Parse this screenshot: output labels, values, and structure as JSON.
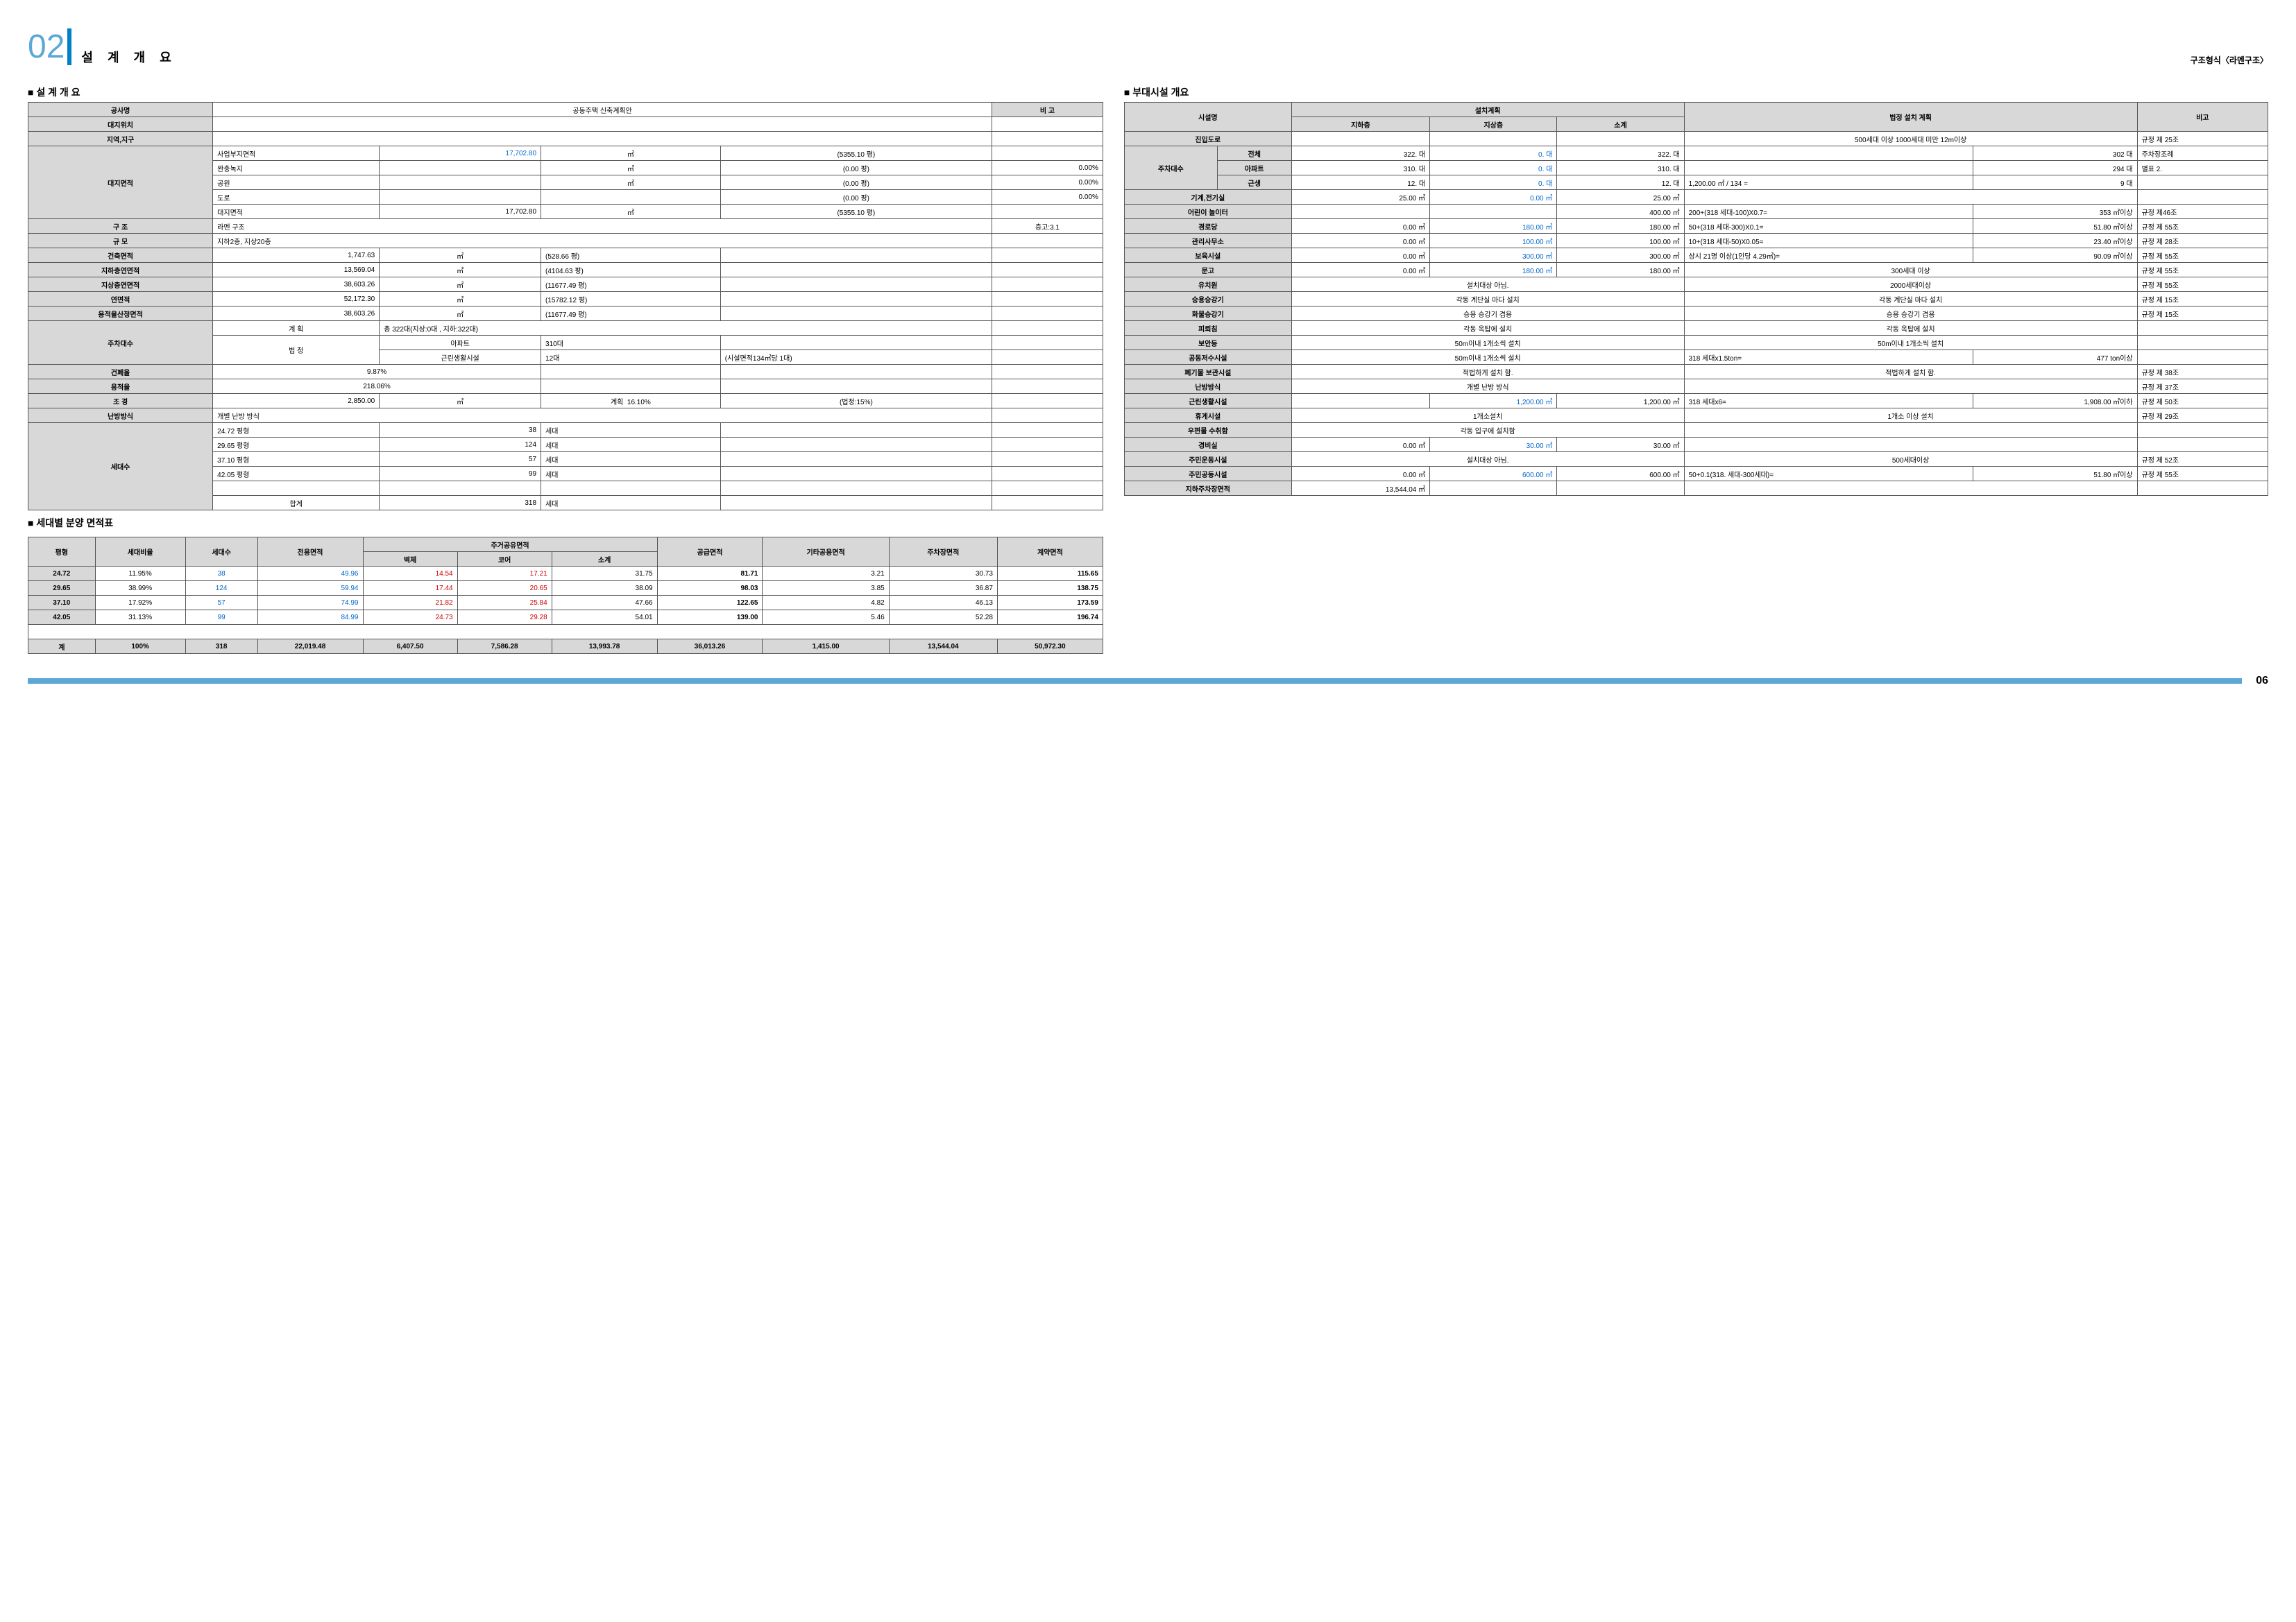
{
  "header": {
    "number_prefix": "0",
    "number_main": "2",
    "title": "설 계 개 요",
    "struct_type": "구조형식〈라멘구조〉",
    "footer_page": "06"
  },
  "sections": {
    "design_overview": "■ 설 계 개 요",
    "area_table": "■ 세대별 분양 면적표",
    "facilities": "■ 부대시설 개요"
  },
  "design": {
    "headers": {
      "project": "공사명",
      "project_val": "공동주택 신축계획안",
      "note": "비 고",
      "site_loc": "대지위치",
      "region": "지역,지구",
      "site_area": "대지면적",
      "structure": "구 조",
      "scale": "규 모",
      "bldg_area": "건축면적",
      "basement_area": "지하층연면적",
      "above_area": "지상층연면적",
      "total_area": "연면적",
      "far_area": "용적율산정면적",
      "parking": "주차대수",
      "bcr": "건폐율",
      "far": "용적율",
      "landscape": "조 경",
      "heating": "난방방식",
      "units": "세대수"
    },
    "site": {
      "biz_area_label": "사업부지면적",
      "biz_area": "17,702.80",
      "biz_unit": "㎡",
      "biz_pyung": "(5355.10 평)",
      "buffer_label": "완충녹지",
      "buffer_val": "",
      "buffer_pyung": "(0.00 평)",
      "buffer_pct": "0.00%",
      "park_label": "공원",
      "park_pyung": "(0.00 평)",
      "park_pct": "0.00%",
      "road_label": "도로",
      "road_pyung": "(0.00 평)",
      "road_pct": "0.00%",
      "lot_label": "대지면적",
      "lot_val": "17,702.80",
      "lot_unit": "㎡",
      "lot_pyung": "(5355.10 평)"
    },
    "structure_val": "라멘 구조",
    "structure_note": "층고:3.1",
    "scale_val": "지하2층, 지상20층",
    "bldg_area_val": "1,747.63",
    "bldg_area_pyung": "(528.66 평)",
    "basement_val": "13,569.04",
    "basement_pyung": "(4104.63 평)",
    "above_val": "38,603.26",
    "above_pyung": "(11677.49 평)",
    "total_val": "52,172.30",
    "total_pyung": "(15782.12 평)",
    "far_area_val": "38,603.26",
    "far_area_pyung": "(11677.49 평)",
    "unit_m2": "㎡",
    "parking": {
      "plan_label": "계 획",
      "plan_val": "총 322대(지상:0대 , 지하:322대)",
      "legal_label": "법 정",
      "apt_label": "아파트",
      "apt_val": "310대",
      "retail_label": "근린생활시설",
      "retail_val": "12대",
      "retail_note": "(시설면적134㎡당 1대)"
    },
    "bcr_val": "9.87%",
    "far_val": "218.06%",
    "landscape_val": "2,850.00",
    "landscape_plan_label": "계획",
    "landscape_plan": "16.10%",
    "landscape_legal": "(법정:15%)",
    "heating_val": "개별 난방 방식",
    "units": {
      "r1_type": "24.72 평형",
      "r1_qty": "38",
      "unit_label": "세대",
      "r2_type": "29.65 평형",
      "r2_qty": "124",
      "r3_type": "37.10 평형",
      "r3_qty": "57",
      "r4_type": "42.05 평형",
      "r4_qty": "99",
      "sum_label": "합계",
      "sum_qty": "318"
    }
  },
  "area_table": {
    "cols": {
      "type": "평형",
      "ratio": "세대비율",
      "count": "세대수",
      "exclusive": "전용면적",
      "share_header": "주거공유면적",
      "wall": "벽체",
      "core": "코어",
      "subtotal": "소계",
      "supply": "공급면적",
      "other": "기타공용면적",
      "parking": "주차장면적",
      "contract": "계약면적",
      "total_label": "계"
    },
    "rows": [
      {
        "type": "24.72",
        "ratio": "11.95%",
        "count": "38",
        "excl": "49.96",
        "wall": "14.54",
        "core": "17.21",
        "sub": "31.75",
        "supply": "81.71",
        "other": "3.21",
        "park": "30.73",
        "contract": "115.65"
      },
      {
        "type": "29.65",
        "ratio": "38.99%",
        "count": "124",
        "excl": "59.94",
        "wall": "17.44",
        "core": "20.65",
        "sub": "38.09",
        "supply": "98.03",
        "other": "3.85",
        "park": "36.87",
        "contract": "138.75"
      },
      {
        "type": "37.10",
        "ratio": "17.92%",
        "count": "57",
        "excl": "74.99",
        "wall": "21.82",
        "core": "25.84",
        "sub": "47.66",
        "supply": "122.65",
        "other": "4.82",
        "park": "46.13",
        "contract": "173.59"
      },
      {
        "type": "42.05",
        "ratio": "31.13%",
        "count": "99",
        "excl": "84.99",
        "wall": "24.73",
        "core": "29.28",
        "sub": "54.01",
        "supply": "139.00",
        "other": "5.46",
        "park": "52.28",
        "contract": "196.74"
      }
    ],
    "totals": {
      "ratio": "100%",
      "count": "318",
      "excl": "22,019.48",
      "wall": "6,407.50",
      "core": "7,586.28",
      "sub": "13,993.78",
      "supply": "36,013.26",
      "other": "1,415.00",
      "park": "13,544.04",
      "contract": "50,972.30"
    }
  },
  "facilities": {
    "cols": {
      "name": "시설명",
      "plan_header": "설치계획",
      "basement": "지하층",
      "above": "지상층",
      "subtotal": "소계",
      "legal": "법정 설치 계획",
      "note": "비고"
    },
    "rows": [
      {
        "name": "진입도로",
        "b": "",
        "a": "",
        "s": "",
        "legal": "500세대 이상 1000세대 미만 12m이상",
        "note": "규정 제 25조"
      },
      {
        "name": "전체",
        "b": "322. 대",
        "a": "0. 대",
        "s": "322. 대",
        "legal": "",
        "legal2": "302 대",
        "note": "주차장조례",
        "sub": "주차대수"
      },
      {
        "name": "아파트",
        "b": "310. 대",
        "a": "0. 대",
        "s": "310. 대",
        "legal": "",
        "legal2": "294 대",
        "note": "별표 2."
      },
      {
        "name": "근생",
        "b": "12. 대",
        "a": "0. 대",
        "s": "12. 대",
        "legal": "1,200.00 ㎡ / 134 =",
        "legal2": "9 대",
        "note": ""
      },
      {
        "name": "기계,전기실",
        "b": "25.00 ㎡",
        "a": "0.00 ㎡",
        "s": "25.00 ㎡",
        "legal": "",
        "note": ""
      },
      {
        "name": "어린이 놀이터",
        "b": "",
        "a": "",
        "s": "400.00 ㎡",
        "legal": "200+(318 세대-100)X0.7=",
        "legal2": "353 ㎡이상",
        "note": "규정 제46조"
      },
      {
        "name": "경로당",
        "b": "0.00 ㎡",
        "a": "180.00 ㎡",
        "s": "180.00 ㎡",
        "legal": "50+(318 세대-300)X0.1=",
        "legal2": "51.80 ㎡이상",
        "note": "규정 제 55조"
      },
      {
        "name": "관리사무소",
        "b": "0.00 ㎡",
        "a": "100.00 ㎡",
        "s": "100.00 ㎡",
        "legal": "10+(318 세대-50)X0.05=",
        "legal2": "23.40 ㎡이상",
        "note": "규정 제 28조"
      },
      {
        "name": "보육시설",
        "b": "0.00 ㎡",
        "a": "300.00 ㎡",
        "s": "300.00 ㎡",
        "legal": "상시 21명 이상(1인당 4.29㎡)=",
        "legal2": "90.09 ㎡이상",
        "note": "규정 제 55조"
      },
      {
        "name": "문고",
        "b": "0.00 ㎡",
        "a": "180.00 ㎡",
        "s": "180.00 ㎡",
        "legal": "300세대 이상",
        "note": "규정 제 55조"
      },
      {
        "name": "유치원",
        "plan_span": "설치대상 아님.",
        "legal": "2000세대이상",
        "note": "규정 제 55조"
      },
      {
        "name": "승용승강기",
        "plan_span": "각동 계단실 마다 설치",
        "legal": "각동 계단실 마다 설치",
        "note": "규정 제 15조"
      },
      {
        "name": "화물승강기",
        "plan_span": "승용 승강기 겸용",
        "legal": "승용 승강기 겸용",
        "note": "규정 제 15조"
      },
      {
        "name": "피뢰침",
        "plan_span": "각동 옥탑에 설치",
        "legal": "각동 옥탑에 설치",
        "note": ""
      },
      {
        "name": "보안등",
        "plan_span": "50m이내 1개소씩 설치",
        "legal": "50m이내 1개소씩 설치",
        "note": ""
      },
      {
        "name": "공동저수시설",
        "plan_span": "50m이내 1개소씩 설치",
        "legal": "318 세대x1.5ton=",
        "legal2": "477 ton이상",
        "note": ""
      },
      {
        "name": "폐기물 보관시설",
        "plan_span": "적법하게 설치 함.",
        "legal": "적법하게 설치 함.",
        "note": "규정 제 38조"
      },
      {
        "name": "난방방식",
        "plan_span": "개별 난방 방식",
        "legal": "",
        "note": "규정 제 37조"
      },
      {
        "name": "근린생활시설",
        "b": "",
        "a": "1,200.00 ㎡",
        "s": "1,200.00 ㎡",
        "legal": "318 세대x6=",
        "legal2": "1,908.00 ㎡이하",
        "note": "규정 제 50조"
      },
      {
        "name": "휴게시설",
        "plan_span": "1개소설치",
        "legal": "1개소 이상 설치",
        "note": "규정 제 29조"
      },
      {
        "name": "우편물 수취함",
        "plan_span": "각동 입구에 설치함",
        "legal": "",
        "note": ""
      },
      {
        "name": "경비실",
        "b": "0.00 ㎡",
        "a": "30.00 ㎡",
        "s": "30.00 ㎡",
        "legal": "",
        "note": ""
      },
      {
        "name": "주민운동시설",
        "plan_span": "설치대상 아님.",
        "legal": "500세대이상",
        "note": "규정 제 52조"
      },
      {
        "name": "주민공동시설",
        "b": "0.00 ㎡",
        "a": "600.00 ㎡",
        "s": "600.00 ㎡",
        "legal": "50+0.1(318. 세대-300세대)=",
        "legal2": "51.80 ㎡이상",
        "note": "규정 제 55조"
      },
      {
        "name": "지하주차장면적",
        "b": "13,544.04 ㎡",
        "a": "",
        "s": "",
        "legal": "",
        "note": ""
      }
    ]
  }
}
